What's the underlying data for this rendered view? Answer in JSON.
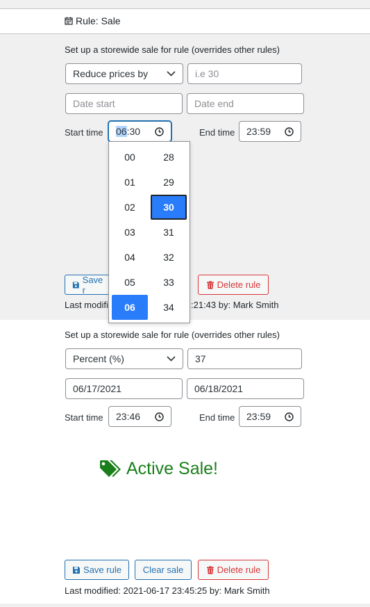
{
  "header": {
    "title": "Rule: Sale",
    "icon": "calendar-icon"
  },
  "rule1": {
    "description": "Set up a storewide sale for rule (overrides other rules)",
    "type_select": "Reduce prices by",
    "value_placeholder": "i.e 30",
    "date_start_placeholder": "Date start",
    "date_end_placeholder": "Date end",
    "start_time_label": "Start time",
    "start_time_hours": "06",
    "start_time_minutes": ":30",
    "end_time_label": "End time",
    "end_time": "23:59",
    "save_label": "Save rule",
    "save_partial": "Save r",
    "delete_label": "Delete rule",
    "modified_prefix": "Last modifi",
    "modified_suffix": ":21:43 by: Mark Smith"
  },
  "time_picker": {
    "hours": [
      "00",
      "01",
      "02",
      "03",
      "04",
      "05",
      "06"
    ],
    "minutes": [
      "28",
      "29",
      "30",
      "31",
      "32",
      "33",
      "34"
    ],
    "selected_hour": "06",
    "selected_minute": "30"
  },
  "rule2": {
    "description": "Set up a storewide sale for rule (overrides other rules)",
    "type_select": "Percent (%)",
    "value": "37",
    "date_start": "06/17/2021",
    "date_end": "06/18/2021",
    "start_time_label": "Start time",
    "start_time": "23:46",
    "end_time_label": "End time",
    "end_time": "23:59",
    "status": "Active Sale!",
    "save_label": "Save rule",
    "clear_label": "Clear sale",
    "delete_label": "Delete rule",
    "modified": "Last modified: 2021-06-17 23:45:25 by: Mark Smith"
  },
  "colors": {
    "accent": "#2271b1",
    "danger": "#d63638",
    "success": "#1a7f1a",
    "picker_selected": "#2a7dfa"
  }
}
